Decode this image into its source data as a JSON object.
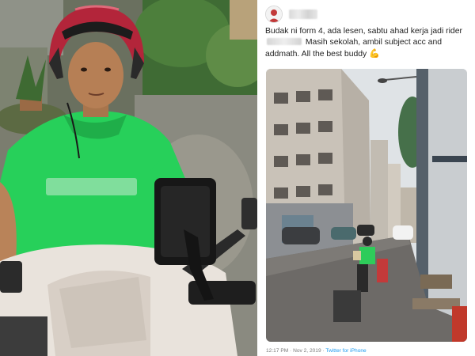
{
  "tweet": {
    "text_part1": "Budak ni form 4, ada lesen, sabtu ahad kerja jadi rider",
    "text_part2": "Masih sekolah, ambil subject acc and addmath. All the best buddy",
    "emoji": "flexed-biceps",
    "timestamp": "12:17 PM · Nov 2, 2019 · ",
    "source": "Twitter for iPhone"
  },
  "colors": {
    "shirt_green": "#27d05a",
    "helmet_red": "#b3253a",
    "link_blue": "#1d9bf0"
  }
}
